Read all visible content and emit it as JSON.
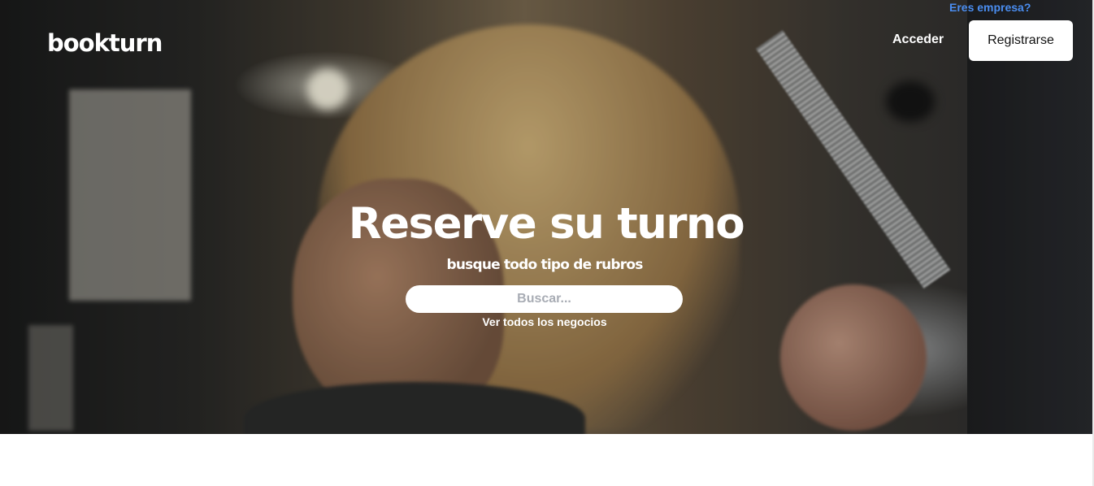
{
  "header": {
    "logo": "bookturn",
    "business_link": "Eres empresa?",
    "login_label": "Acceder",
    "register_label": "Registrarse"
  },
  "hero": {
    "title": "Reserve su turno",
    "subtitle": "busque todo tipo de rubros",
    "search_placeholder": "Buscar...",
    "all_businesses_link": "Ver todos los negocios"
  },
  "colors": {
    "accent_link": "#4a8df0",
    "button_bg": "#ffffff",
    "hero_text": "#ffffff"
  }
}
